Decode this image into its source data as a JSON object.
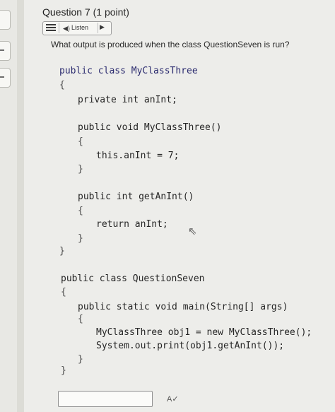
{
  "question": {
    "title": "Question 7",
    "points": "(1 point)",
    "prompt": "What output is produced when the class QuestionSeven is run?"
  },
  "listen": {
    "label": "Listen",
    "icons": {
      "menu": "menu-icon",
      "speaker": "speaker-icon",
      "play": "play-icon"
    }
  },
  "code": {
    "lines": [
      {
        "id": "l1",
        "text": "public class MyClassThree"
      },
      {
        "id": "l2",
        "text": "{"
      },
      {
        "id": "l3",
        "text": "private int anInt;"
      },
      {
        "id": "l4",
        "text": "public void MyClassThree()"
      },
      {
        "id": "l5",
        "text": "{"
      },
      {
        "id": "l6",
        "text": "this.anInt = 7;"
      },
      {
        "id": "l7",
        "text": "}"
      },
      {
        "id": "l8",
        "text": "public int getAnInt()"
      },
      {
        "id": "l9",
        "text": "{"
      },
      {
        "id": "l10",
        "text": "return anInt;"
      },
      {
        "id": "l11",
        "text": "}"
      },
      {
        "id": "l12",
        "text": "}"
      },
      {
        "id": "l13",
        "text": "public class QuestionSeven"
      },
      {
        "id": "l14",
        "text": "{"
      },
      {
        "id": "l15",
        "text": "public static void main(String[] args)"
      },
      {
        "id": "l16",
        "text": "{"
      },
      {
        "id": "l17",
        "text": "MyClassThree obj1 = new MyClassThree();"
      },
      {
        "id": "l18",
        "text": "System.out.print(obj1.getAnInt());"
      },
      {
        "id": "l19",
        "text": "}"
      },
      {
        "id": "l20",
        "text": "}"
      }
    ]
  },
  "answer": {
    "value": "",
    "spellcheck_icon": "spellcheck-icon"
  },
  "colors": {
    "keyword": "#2a2a6e",
    "class_name": "#2f3c8f",
    "background": "#ededea"
  }
}
